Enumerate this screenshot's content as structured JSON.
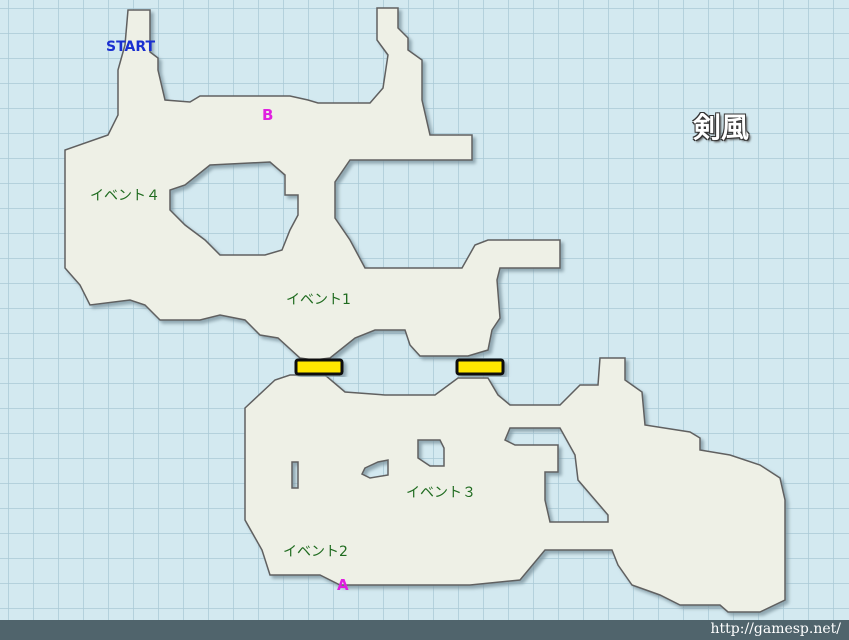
{
  "map": {
    "title": "剣風",
    "start_label": "START",
    "markers": {
      "a": "A",
      "b": "B"
    },
    "events": {
      "event1": "イベント1",
      "event2": "イベント2",
      "event3": "イベント３",
      "event4": "イベント４"
    },
    "colors": {
      "water": "#d3e9f0",
      "grid_line": "#a9c9d6",
      "land": "#eef0e6",
      "outline": "#606060",
      "bridge": "#ffe600",
      "start_text": "#1a2fd0",
      "marker_text": "#e020e0",
      "event_text": "#1f6b1f",
      "footer": "#50646c"
    }
  },
  "footer": {
    "url": "http://gamesp.net/"
  }
}
